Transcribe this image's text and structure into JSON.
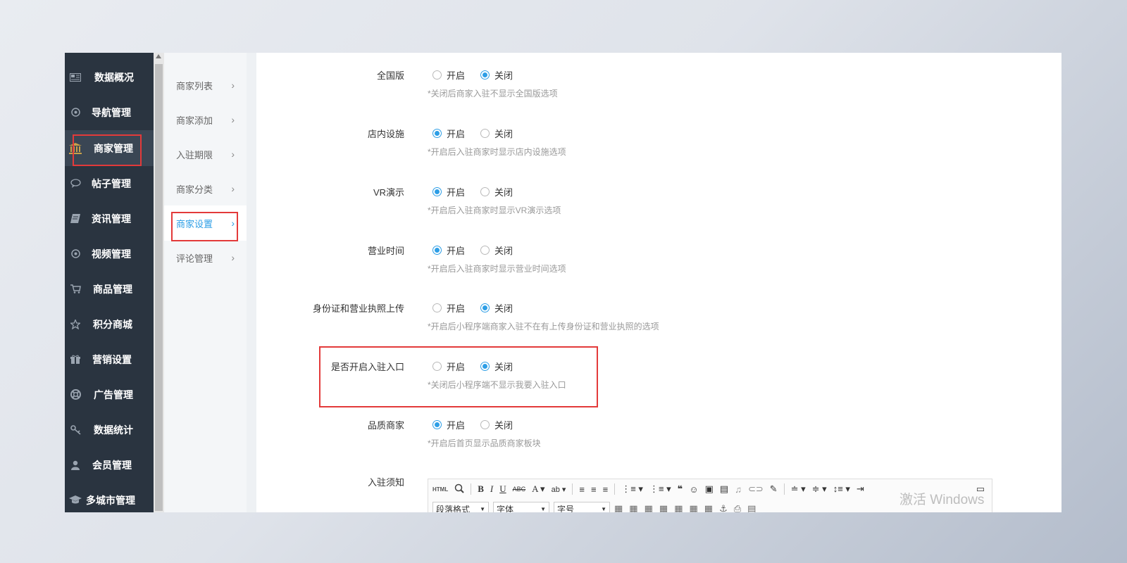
{
  "sidebar": {
    "items": [
      {
        "label": "数据概况",
        "icon": "newspaper-icon",
        "active": false
      },
      {
        "label": "导航管理",
        "icon": "compass-icon",
        "active": false
      },
      {
        "label": "商家管理",
        "icon": "bank-icon",
        "active": true
      },
      {
        "label": "帖子管理",
        "icon": "chat-bubble-icon",
        "active": false
      },
      {
        "label": "资讯管理",
        "icon": "book-icon",
        "active": false
      },
      {
        "label": "视频管理",
        "icon": "compass-icon",
        "active": false
      },
      {
        "label": "商品管理",
        "icon": "cart-icon",
        "active": false
      },
      {
        "label": "积分商城",
        "icon": "star-icon",
        "active": false
      },
      {
        "label": "营销设置",
        "icon": "gift-icon",
        "active": false
      },
      {
        "label": "广告管理",
        "icon": "lifebuoy-icon",
        "active": false
      },
      {
        "label": "数据统计",
        "icon": "key-icon",
        "active": false
      },
      {
        "label": "会员管理",
        "icon": "user-icon",
        "active": false
      },
      {
        "label": "多城市管理",
        "icon": "graduation-cap-icon",
        "active": false
      }
    ]
  },
  "submenu": {
    "items": [
      {
        "label": "商家列表",
        "active": false
      },
      {
        "label": "商家添加",
        "active": false
      },
      {
        "label": "入驻期限",
        "active": false
      },
      {
        "label": "商家分类",
        "active": false
      },
      {
        "label": "商家设置",
        "active": true
      },
      {
        "label": "评论管理",
        "active": false
      }
    ],
    "chevron": "›"
  },
  "settings": {
    "on_label": "开启",
    "off_label": "关闭",
    "rows": [
      {
        "label": "全国版",
        "selected": "off",
        "hint": "*关闭后商家入驻不显示全国版选项"
      },
      {
        "label": "店内设施",
        "selected": "on",
        "hint": "*开启后入驻商家时显示店内设施选项"
      },
      {
        "label": "VR演示",
        "selected": "on",
        "hint": "*开启后入驻商家时显示VR演示选项"
      },
      {
        "label": "营业时间",
        "selected": "on",
        "hint": "*开启后入驻商家时显示营业时间选项"
      },
      {
        "label": "身份证和营业执照上传",
        "selected": "off",
        "hint": "*开启后小程序端商家入驻不在有上传身份证和营业执照的选项"
      },
      {
        "label": "是否开启入驻入口",
        "selected": "off",
        "hint": "*关闭后小程序端不显示我要入驻入口"
      },
      {
        "label": "品质商家",
        "selected": "on",
        "hint": "*开启后首页显示品质商家板块"
      }
    ],
    "editor_label": "入驻须知"
  },
  "editor": {
    "paragraph_select": "段落格式",
    "font_select": "字体",
    "size_select": "字号",
    "html_btn": "HTML"
  },
  "watermark": "激活 Windows",
  "colors": {
    "accent": "#2d9ee6",
    "sidebar_bg": "#2a3440",
    "highlight": "#e33a3a"
  }
}
